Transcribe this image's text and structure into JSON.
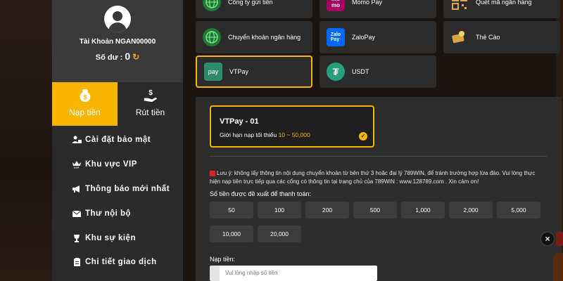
{
  "account": {
    "name": "Tài Khoản NGAN00000",
    "balance_label": "Số dư :",
    "balance_value": "0"
  },
  "tabs": {
    "deposit": "Nạp tiền",
    "withdraw": "Rút tiền"
  },
  "menu": [
    {
      "label": "Cài đặt bảo mật",
      "icon": "user-lock-icon"
    },
    {
      "label": "Khu vực VIP",
      "icon": "vip-crown-icon"
    },
    {
      "label": "Thông báo mới nhất",
      "icon": "megaphone-icon"
    },
    {
      "label": "Thư nội bộ",
      "icon": "envelope-icon"
    },
    {
      "label": "Khu sự kiện",
      "icon": "trophy-icon"
    },
    {
      "label": "Chi tiết giao dịch",
      "icon": "clipboard-icon"
    }
  ],
  "methods": [
    {
      "label": "Công ty gửi tiền",
      "icon": "globe-icon"
    },
    {
      "label": "Momo Pay",
      "icon": "momo-icon"
    },
    {
      "label": "Quét mã ngân hàng",
      "icon": "qr-code-icon"
    },
    {
      "label": "Chuyển khoản ngân hàng",
      "icon": "globe-icon"
    },
    {
      "label": "ZaloPay",
      "icon": "zalopay-icon"
    },
    {
      "label": "Thẻ Cào",
      "icon": "scratch-card-icon"
    },
    {
      "label": "VTPay",
      "icon": "vtpay-icon",
      "selected": true
    },
    {
      "label": "USDT",
      "icon": "usdt-icon"
    }
  ],
  "channel": {
    "title": "VTPay - 01",
    "limit_label": "Giới hạn nạp tối thiểu",
    "limit_range": "10 ~ 50,000"
  },
  "notice": "Lưu ý: không lấy thông tin nội dung chuyển khoản từ bên thứ 3 hoặc đại lý 789WIN, để tránh trường hợp lừa đảo. Vui lòng thực hiện nạp tiền trực tiếp qua các cổng có thông tin tại trang chủ của 789WiN : www.128789.com . Xin cảm ơn!",
  "suggest_label": "Số tiền được đề xuất để thanh toán:",
  "amounts": [
    "50",
    "100",
    "200",
    "500",
    "1,000",
    "2,000",
    "5,000",
    "10,000",
    "20,000"
  ],
  "deposit_input": {
    "label": "Nạp tiền:",
    "placeholder": "Vui lòng nhập số tiền"
  },
  "colors": {
    "accent": "#f7b500",
    "momo": "#a50064",
    "zalopay": "#0068ff",
    "vtpay": "#2e8b6e",
    "usdt": "#26a17b"
  }
}
